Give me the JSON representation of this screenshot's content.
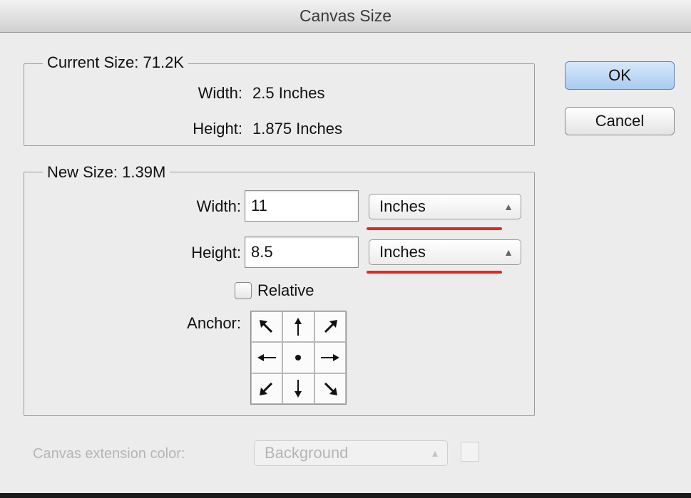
{
  "dialog": {
    "title": "Canvas Size"
  },
  "buttons": {
    "ok": "OK",
    "cancel": "Cancel"
  },
  "current_size": {
    "legend": "Current Size: 71.2K",
    "width_label": "Width:",
    "width_value": "2.5 Inches",
    "height_label": "Height:",
    "height_value": "1.875 Inches"
  },
  "new_size": {
    "legend": "New Size: 1.39M",
    "width_label": "Width:",
    "width_value": "11",
    "width_unit": "Inches",
    "height_label": "Height:",
    "height_value": "8.5",
    "height_unit": "Inches",
    "relative_label": "Relative",
    "relative_checked": false,
    "anchor_label": "Anchor:",
    "anchor_selected": "center"
  },
  "extension_color": {
    "label": "Canvas extension color:",
    "value": "Background",
    "enabled": false
  },
  "annotation": {
    "underline_color": "#e8251a"
  },
  "colors": {
    "default_button": "#aacbf0"
  }
}
